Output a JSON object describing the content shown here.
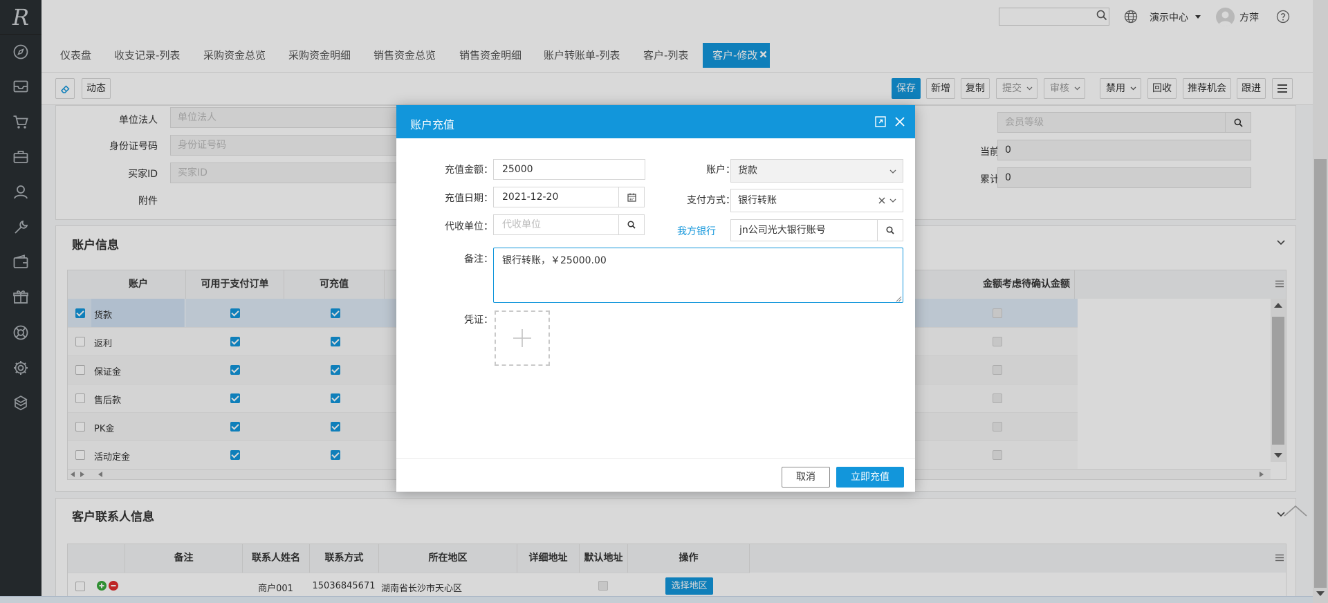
{
  "sidebar": {
    "logo": "R",
    "icons": [
      "compass-icon",
      "inbox-icon",
      "cart-icon",
      "briefcase-icon",
      "user-icon",
      "wrench-icon",
      "wallet-icon",
      "gift-icon",
      "lifebuoy-icon",
      "gear-icon",
      "cubes-icon"
    ]
  },
  "topbar": {
    "search_placeholder": "",
    "center_label": "演示中心",
    "user_name": "方萍"
  },
  "tabs": [
    "仪表盘",
    "收支记录-列表",
    "采购资金总览",
    "采购资金明细",
    "销售资金总览",
    "销售资金明细",
    "账户转账单-列表",
    "客户-列表"
  ],
  "active_tab": "客户-修改",
  "toolbar": {
    "dynamic_label": "动态",
    "save": "保存",
    "add": "新增",
    "copy": "复制",
    "submit": "提交",
    "audit": "审核",
    "disable": "禁用",
    "recycle": "回收",
    "recommend": "推荐机会",
    "follow": "跟进"
  },
  "form": {
    "legal_person_label": "单位法人",
    "legal_person_placeholder": "单位法人",
    "id_no_label": "身份证号码",
    "id_no_placeholder": "身份证号码",
    "buyer_id_label": "买家ID",
    "buyer_id_placeholder": "买家ID",
    "attachment_label": "附件",
    "member_level_label": "会员等级",
    "member_level_placeholder": "会员等级",
    "points_label": "当前会员积分",
    "points_value": "0",
    "total_spent_label": "累计消费金额",
    "total_spent_value": "0"
  },
  "account_section": {
    "title": "账户信息",
    "columns": [
      "账户",
      "可用于支付订单",
      "可充值"
    ],
    "right_column": "金额考虑待确认金额",
    "rows": [
      {
        "name": "货款",
        "selected": true
      },
      {
        "name": "返利",
        "selected": false
      },
      {
        "name": "保证金",
        "selected": false
      },
      {
        "name": "售后款",
        "selected": false
      },
      {
        "name": "PK金",
        "selected": false
      },
      {
        "name": "活动定金",
        "selected": false
      }
    ]
  },
  "contact_section": {
    "title": "客户联系人信息",
    "columns": [
      "备注",
      "联系人姓名",
      "联系方式",
      "所在地区",
      "详细地址",
      "默认地址",
      "操作"
    ],
    "rows": [
      {
        "name": "商户001",
        "phone": "15036845671",
        "region": "湖南省长沙市天心区",
        "action": "选择地区"
      }
    ]
  },
  "modal": {
    "title": "账户充值",
    "amount_label": "充值金额：",
    "amount_value": "25000",
    "date_label": "充值日期：",
    "date_value": "2021-12-20",
    "collector_label": "代收单位：",
    "collector_placeholder": "代收单位",
    "account_label": "账户：",
    "account_value": "货款",
    "pay_method_label": "支付方式：",
    "pay_method_value": "银行转账",
    "our_bank_label": "我方银行",
    "our_bank_value": "jn公司光大银行账号",
    "remark_label": "备注：",
    "remark_value": "银行转账，￥25000.00",
    "voucher_label": "凭证：",
    "cancel": "取消",
    "confirm": "立即充值"
  }
}
